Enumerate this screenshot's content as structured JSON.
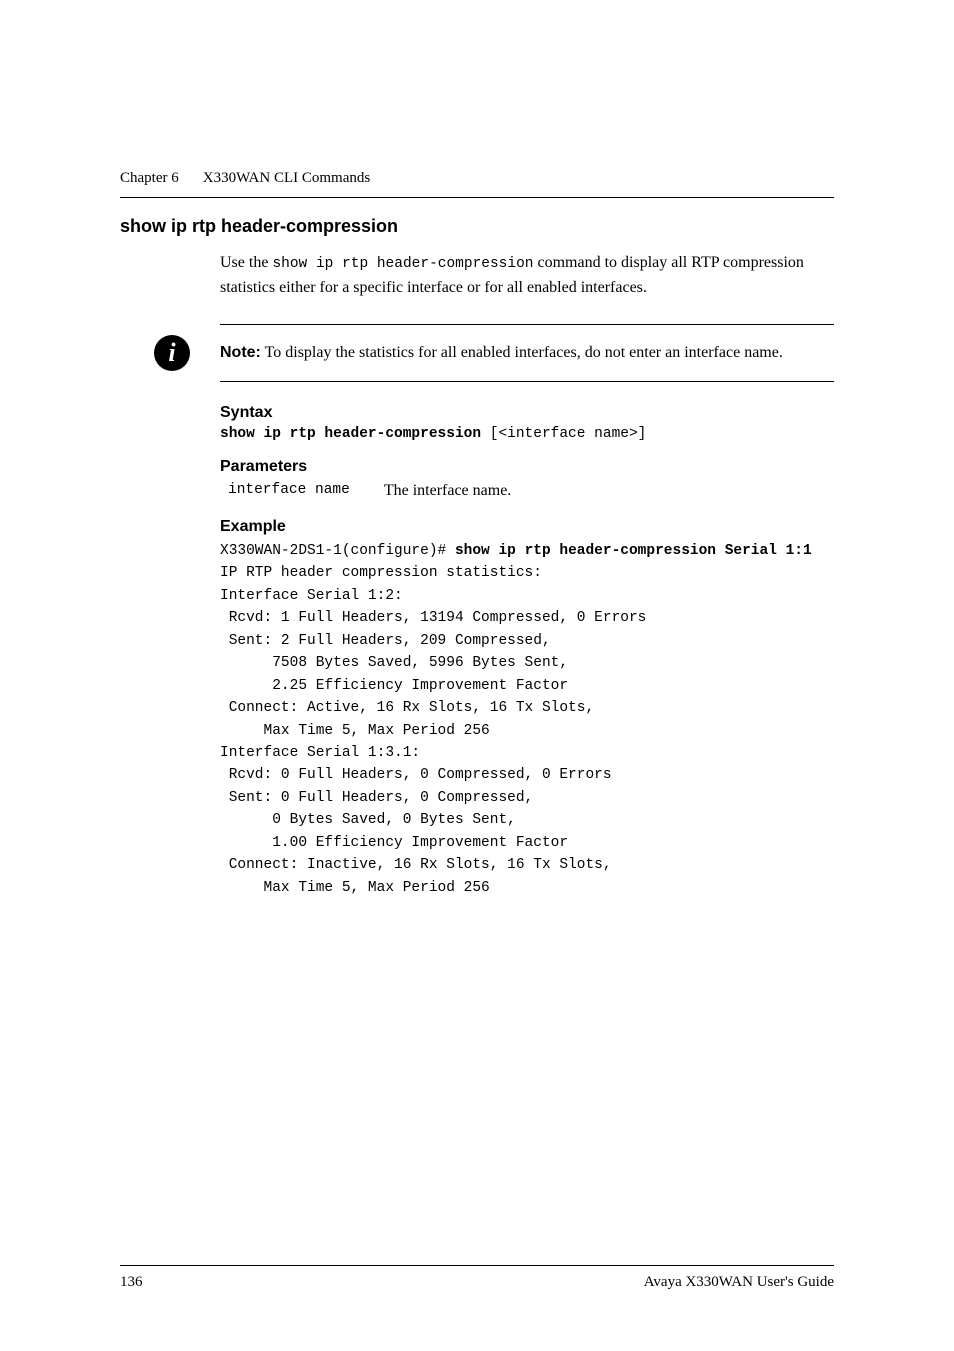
{
  "header": {
    "chapter_label": "Chapter 6",
    "chapter_title": "X330WAN CLI Commands"
  },
  "section": {
    "title": "show ip rtp header-compression",
    "intro_prefix": "Use the ",
    "intro_cmd": "show ip rtp header-compression",
    "intro_suffix": " command to display all RTP compression statistics either for a specific interface or for all enabled interfaces."
  },
  "note": {
    "icon": "i",
    "label": "Note:",
    "text": "  To display the statistics for all enabled interfaces, do not enter an interface name."
  },
  "syntax": {
    "heading": "Syntax",
    "cmd_bold": "show ip rtp header-compression",
    "cmd_rest": " [<interface name>]"
  },
  "parameters": {
    "heading": "Parameters",
    "rows": [
      {
        "name": "interface name",
        "desc": "The interface name."
      }
    ]
  },
  "example": {
    "heading": "Example",
    "prompt": "X330WAN-2DS1-1(configure)# ",
    "cmd": "show ip rtp header-compression Serial 1:1",
    "output": "IP RTP header compression statistics:\nInterface Serial 1:2:\n Rcvd: 1 Full Headers, 13194 Compressed, 0 Errors\n Sent: 2 Full Headers, 209 Compressed,\n      7508 Bytes Saved, 5996 Bytes Sent,\n      2.25 Efficiency Improvement Factor\n Connect: Active, 16 Rx Slots, 16 Tx Slots,\n     Max Time 5, Max Period 256\nInterface Serial 1:3.1:\n Rcvd: 0 Full Headers, 0 Compressed, 0 Errors\n Sent: 0 Full Headers, 0 Compressed,\n      0 Bytes Saved, 0 Bytes Sent,\n      1.00 Efficiency Improvement Factor\n Connect: Inactive, 16 Rx Slots, 16 Tx Slots,\n     Max Time 5, Max Period 256"
  },
  "footer": {
    "page": "136",
    "guide": "Avaya X330WAN User's Guide"
  }
}
